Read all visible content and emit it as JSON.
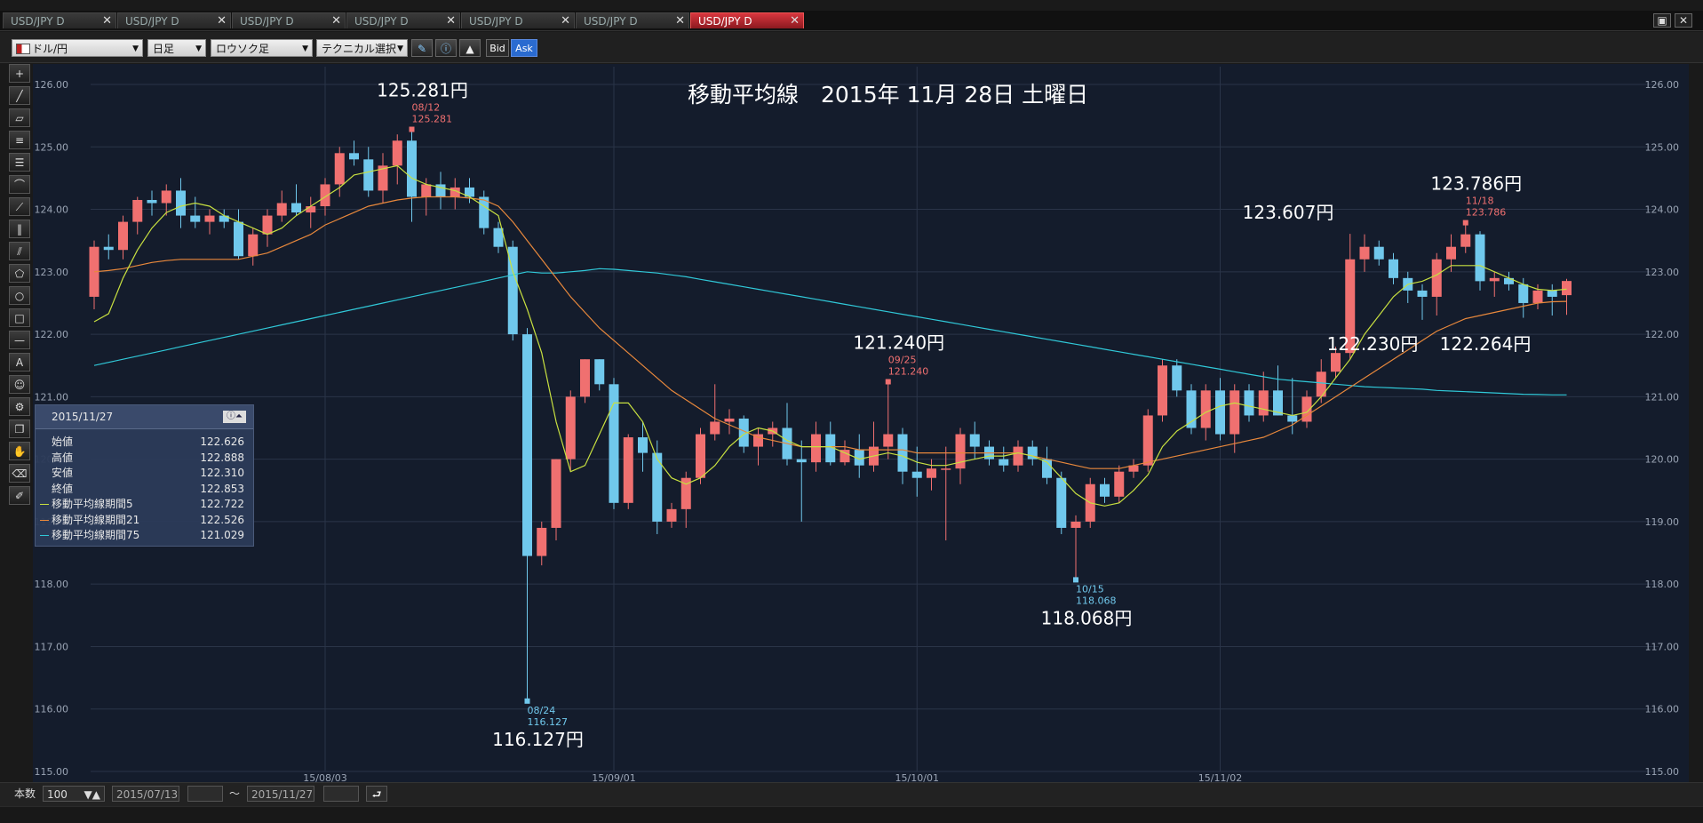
{
  "tabs": [
    {
      "label": "USD/JPY D",
      "active": false
    },
    {
      "label": "USD/JPY D",
      "active": false
    },
    {
      "label": "USD/JPY D",
      "active": false
    },
    {
      "label": "USD/JPY D",
      "active": false
    },
    {
      "label": "USD/JPY D",
      "active": false
    },
    {
      "label": "USD/JPY D",
      "active": false
    },
    {
      "label": "USD/JPY D",
      "active": true
    }
  ],
  "toolbar": {
    "currency": "ドル/円",
    "period": "日足",
    "chart_type": "ロウソク足",
    "technical": "テクニカル選択",
    "bid": "Bid",
    "ask": "Ask"
  },
  "footer": {
    "count_label": "本数",
    "count_value": "100",
    "date_from": "2015/07/13",
    "tilde": "〜",
    "date_to": "2015/11/27"
  },
  "info_panel": {
    "date": "2015/11/27",
    "rows": [
      {
        "label": "始値",
        "value": "122.626"
      },
      {
        "label": "高値",
        "value": "122.888"
      },
      {
        "label": "安値",
        "value": "122.310"
      },
      {
        "label": "終値",
        "value": "122.853"
      },
      {
        "label": "移動平均線期間5",
        "value": "122.722"
      },
      {
        "label": "移動平均線期間21",
        "value": "122.526"
      },
      {
        "label": "移動平均線期間75",
        "value": "121.029"
      }
    ]
  },
  "colors": {
    "up": "#f07070",
    "down": "#70c8ec",
    "ma5": "#c8e040",
    "ma21": "#e8883c",
    "ma75": "#30c8d8",
    "bg": "#141c2c"
  },
  "chart_data": {
    "type": "candlestick",
    "title": "移動平均線　2015年 11月 28日 土曜日",
    "ylim": [
      115.0,
      126.0
    ],
    "yticks": [
      "126.00",
      "125.00",
      "124.00",
      "123.00",
      "122.00",
      "121.00",
      "120.00",
      "119.00",
      "118.00",
      "117.00",
      "116.00",
      "115.00"
    ],
    "xticks": [
      {
        "index": 16,
        "label": "15/08/03"
      },
      {
        "index": 36,
        "label": "15/09/01"
      },
      {
        "index": 57,
        "label": "15/10/01"
      },
      {
        "index": 78,
        "label": "15/11/02"
      }
    ],
    "candles": [
      {
        "o": 122.6,
        "h": 123.5,
        "l": 122.4,
        "c": 123.4
      },
      {
        "o": 123.4,
        "h": 123.6,
        "l": 123.2,
        "c": 123.35
      },
      {
        "o": 123.35,
        "h": 123.9,
        "l": 123.2,
        "c": 123.8
      },
      {
        "o": 123.8,
        "h": 124.2,
        "l": 123.6,
        "c": 124.15
      },
      {
        "o": 124.15,
        "h": 124.3,
        "l": 123.9,
        "c": 124.1
      },
      {
        "o": 124.1,
        "h": 124.4,
        "l": 123.9,
        "c": 124.3
      },
      {
        "o": 124.3,
        "h": 124.5,
        "l": 123.7,
        "c": 123.9
      },
      {
        "o": 123.9,
        "h": 124.2,
        "l": 123.7,
        "c": 123.8
      },
      {
        "o": 123.8,
        "h": 124.0,
        "l": 123.6,
        "c": 123.9
      },
      {
        "o": 123.9,
        "h": 124.0,
        "l": 123.7,
        "c": 123.8
      },
      {
        "o": 123.8,
        "h": 124.0,
        "l": 123.2,
        "c": 123.25
      },
      {
        "o": 123.25,
        "h": 123.7,
        "l": 123.1,
        "c": 123.6
      },
      {
        "o": 123.6,
        "h": 124.0,
        "l": 123.4,
        "c": 123.9
      },
      {
        "o": 123.9,
        "h": 124.3,
        "l": 123.8,
        "c": 124.1
      },
      {
        "o": 124.1,
        "h": 124.4,
        "l": 123.9,
        "c": 123.95
      },
      {
        "o": 123.95,
        "h": 124.2,
        "l": 123.7,
        "c": 124.05
      },
      {
        "o": 124.05,
        "h": 124.5,
        "l": 123.9,
        "c": 124.4
      },
      {
        "o": 124.4,
        "h": 125.0,
        "l": 124.2,
        "c": 124.9
      },
      {
        "o": 124.9,
        "h": 125.1,
        "l": 124.7,
        "c": 124.8
      },
      {
        "o": 124.8,
        "h": 125.0,
        "l": 124.2,
        "c": 124.3
      },
      {
        "o": 124.3,
        "h": 124.9,
        "l": 124.1,
        "c": 124.7
      },
      {
        "o": 124.7,
        "h": 125.2,
        "l": 124.4,
        "c": 125.1
      },
      {
        "o": 125.1,
        "h": 125.281,
        "l": 123.8,
        "c": 124.2
      },
      {
        "o": 124.2,
        "h": 124.5,
        "l": 123.9,
        "c": 124.4
      },
      {
        "o": 124.4,
        "h": 124.6,
        "l": 124.0,
        "c": 124.2
      },
      {
        "o": 124.2,
        "h": 124.5,
        "l": 124.0,
        "c": 124.35
      },
      {
        "o": 124.35,
        "h": 124.5,
        "l": 124.1,
        "c": 124.2
      },
      {
        "o": 124.2,
        "h": 124.3,
        "l": 123.6,
        "c": 123.7
      },
      {
        "o": 123.7,
        "h": 123.8,
        "l": 123.3,
        "c": 123.4
      },
      {
        "o": 123.4,
        "h": 123.5,
        "l": 121.9,
        "c": 122.0
      },
      {
        "o": 122.0,
        "h": 122.1,
        "l": 116.127,
        "c": 118.45
      },
      {
        "o": 118.45,
        "h": 119.0,
        "l": 118.3,
        "c": 118.9
      },
      {
        "o": 118.9,
        "h": 120.0,
        "l": 118.7,
        "c": 120.0
      },
      {
        "o": 120.0,
        "h": 121.1,
        "l": 119.8,
        "c": 121.0
      },
      {
        "o": 121.0,
        "h": 121.6,
        "l": 120.9,
        "c": 121.6
      },
      {
        "o": 121.6,
        "h": 121.6,
        "l": 121.1,
        "c": 121.2
      },
      {
        "o": 121.2,
        "h": 121.3,
        "l": 119.2,
        "c": 119.3
      },
      {
        "o": 119.3,
        "h": 120.4,
        "l": 119.2,
        "c": 120.35
      },
      {
        "o": 120.35,
        "h": 120.6,
        "l": 119.8,
        "c": 120.1
      },
      {
        "o": 120.1,
        "h": 120.3,
        "l": 118.8,
        "c": 119.0
      },
      {
        "o": 119.0,
        "h": 119.3,
        "l": 118.9,
        "c": 119.2
      },
      {
        "o": 119.2,
        "h": 119.8,
        "l": 118.9,
        "c": 119.7
      },
      {
        "o": 119.7,
        "h": 120.5,
        "l": 119.6,
        "c": 120.4
      },
      {
        "o": 120.4,
        "h": 121.2,
        "l": 120.3,
        "c": 120.6
      },
      {
        "o": 120.6,
        "h": 120.8,
        "l": 120.4,
        "c": 120.65
      },
      {
        "o": 120.65,
        "h": 120.7,
        "l": 120.1,
        "c": 120.2
      },
      {
        "o": 120.2,
        "h": 120.5,
        "l": 119.9,
        "c": 120.4
      },
      {
        "o": 120.4,
        "h": 120.6,
        "l": 120.2,
        "c": 120.5
      },
      {
        "o": 120.5,
        "h": 120.9,
        "l": 119.9,
        "c": 120.0
      },
      {
        "o": 120.0,
        "h": 120.3,
        "l": 119.0,
        "c": 119.95
      },
      {
        "o": 119.95,
        "h": 120.6,
        "l": 119.8,
        "c": 120.4
      },
      {
        "o": 120.4,
        "h": 120.6,
        "l": 119.9,
        "c": 119.95
      },
      {
        "o": 119.95,
        "h": 120.3,
        "l": 119.9,
        "c": 120.15
      },
      {
        "o": 120.15,
        "h": 120.4,
        "l": 119.7,
        "c": 119.9
      },
      {
        "o": 119.9,
        "h": 120.6,
        "l": 119.8,
        "c": 120.2
      },
      {
        "o": 120.2,
        "h": 121.24,
        "l": 120.0,
        "c": 120.4
      },
      {
        "o": 120.4,
        "h": 120.5,
        "l": 119.6,
        "c": 119.8
      },
      {
        "o": 119.8,
        "h": 120.2,
        "l": 119.4,
        "c": 119.7
      },
      {
        "o": 119.7,
        "h": 120.0,
        "l": 119.5,
        "c": 119.85
      },
      {
        "o": 119.85,
        "h": 120.2,
        "l": 118.7,
        "c": 119.85
      },
      {
        "o": 119.85,
        "h": 120.5,
        "l": 119.6,
        "c": 120.4
      },
      {
        "o": 120.4,
        "h": 120.6,
        "l": 120.0,
        "c": 120.2
      },
      {
        "o": 120.2,
        "h": 120.3,
        "l": 119.9,
        "c": 120.0
      },
      {
        "o": 120.0,
        "h": 120.2,
        "l": 119.8,
        "c": 119.9
      },
      {
        "o": 119.9,
        "h": 120.3,
        "l": 119.8,
        "c": 120.2
      },
      {
        "o": 120.2,
        "h": 120.3,
        "l": 119.9,
        "c": 120.0
      },
      {
        "o": 120.0,
        "h": 120.2,
        "l": 119.6,
        "c": 119.7
      },
      {
        "o": 119.7,
        "h": 119.8,
        "l": 118.8,
        "c": 118.9
      },
      {
        "o": 118.9,
        "h": 119.1,
        "l": 118.068,
        "c": 119.0
      },
      {
        "o": 119.0,
        "h": 119.7,
        "l": 118.9,
        "c": 119.6
      },
      {
        "o": 119.6,
        "h": 119.7,
        "l": 119.3,
        "c": 119.4
      },
      {
        "o": 119.4,
        "h": 119.9,
        "l": 119.3,
        "c": 119.8
      },
      {
        "o": 119.8,
        "h": 120.0,
        "l": 119.7,
        "c": 119.9
      },
      {
        "o": 119.9,
        "h": 120.8,
        "l": 119.8,
        "c": 120.7
      },
      {
        "o": 120.7,
        "h": 121.6,
        "l": 120.6,
        "c": 121.5
      },
      {
        "o": 121.5,
        "h": 121.6,
        "l": 121.0,
        "c": 121.1
      },
      {
        "o": 121.1,
        "h": 121.2,
        "l": 120.4,
        "c": 120.5
      },
      {
        "o": 120.5,
        "h": 121.2,
        "l": 120.3,
        "c": 121.1
      },
      {
        "o": 121.1,
        "h": 121.3,
        "l": 120.3,
        "c": 120.4
      },
      {
        "o": 120.4,
        "h": 121.2,
        "l": 120.1,
        "c": 121.1
      },
      {
        "o": 121.1,
        "h": 121.2,
        "l": 120.6,
        "c": 120.7
      },
      {
        "o": 120.7,
        "h": 121.4,
        "l": 120.6,
        "c": 121.1
      },
      {
        "o": 121.1,
        "h": 121.5,
        "l": 120.7,
        "c": 120.7
      },
      {
        "o": 120.7,
        "h": 121.3,
        "l": 120.4,
        "c": 120.6
      },
      {
        "o": 120.6,
        "h": 121.1,
        "l": 120.5,
        "c": 121.0
      },
      {
        "o": 121.0,
        "h": 121.6,
        "l": 120.9,
        "c": 121.4
      },
      {
        "o": 121.4,
        "h": 121.8,
        "l": 121.3,
        "c": 121.7
      },
      {
        "o": 121.7,
        "h": 123.607,
        "l": 121.6,
        "c": 123.2
      },
      {
        "o": 123.2,
        "h": 123.6,
        "l": 123.0,
        "c": 123.4
      },
      {
        "o": 123.4,
        "h": 123.5,
        "l": 123.1,
        "c": 123.2
      },
      {
        "o": 123.2,
        "h": 123.3,
        "l": 122.8,
        "c": 122.9
      },
      {
        "o": 122.9,
        "h": 123.0,
        "l": 122.5,
        "c": 122.7
      },
      {
        "o": 122.7,
        "h": 122.8,
        "l": 122.23,
        "c": 122.6
      },
      {
        "o": 122.6,
        "h": 123.3,
        "l": 122.3,
        "c": 123.2
      },
      {
        "o": 123.2,
        "h": 123.6,
        "l": 123.0,
        "c": 123.4
      },
      {
        "o": 123.4,
        "h": 123.786,
        "l": 123.3,
        "c": 123.6
      },
      {
        "o": 123.6,
        "h": 123.65,
        "l": 122.7,
        "c": 122.85
      },
      {
        "o": 122.85,
        "h": 123.0,
        "l": 122.6,
        "c": 122.9
      },
      {
        "o": 122.9,
        "h": 123.0,
        "l": 122.7,
        "c": 122.8
      },
      {
        "o": 122.8,
        "h": 122.9,
        "l": 122.264,
        "c": 122.5
      },
      {
        "o": 122.5,
        "h": 122.8,
        "l": 122.4,
        "c": 122.7
      },
      {
        "o": 122.7,
        "h": 122.8,
        "l": 122.3,
        "c": 122.6
      },
      {
        "o": 122.626,
        "h": 122.888,
        "l": 122.31,
        "c": 122.853
      }
    ],
    "ma5": [
      122.2,
      122.33,
      122.9,
      123.35,
      123.7,
      123.95,
      124.05,
      124.1,
      124.05,
      123.9,
      123.8,
      123.7,
      123.6,
      123.7,
      123.9,
      124.05,
      124.2,
      124.35,
      124.55,
      124.6,
      124.65,
      124.7,
      124.5,
      124.4,
      124.35,
      124.3,
      124.2,
      124.05,
      123.9,
      123.0,
      122.4,
      121.7,
      120.6,
      119.8,
      119.9,
      120.4,
      120.9,
      120.9,
      120.6,
      120.0,
      119.7,
      119.6,
      119.7,
      119.9,
      120.2,
      120.4,
      120.5,
      120.45,
      120.3,
      120.2,
      120.2,
      120.2,
      120.1,
      120.0,
      120.05,
      120.1,
      120.05,
      119.95,
      119.9,
      119.9,
      119.95,
      120.0,
      120.05,
      120.05,
      120.1,
      120.05,
      119.95,
      119.7,
      119.45,
      119.3,
      119.25,
      119.3,
      119.5,
      119.75,
      120.2,
      120.45,
      120.6,
      120.75,
      120.85,
      120.9,
      120.85,
      120.8,
      120.75,
      120.7,
      120.75,
      121.0,
      121.3,
      121.6,
      122.0,
      122.3,
      122.6,
      122.8,
      122.85,
      122.95,
      123.1,
      123.1,
      123.1,
      123.0,
      122.9,
      122.8,
      122.72,
      122.7,
      122.722
    ],
    "ma21": [
      123.0,
      123.02,
      123.05,
      123.1,
      123.15,
      123.18,
      123.2,
      123.2,
      123.2,
      123.2,
      123.2,
      123.25,
      123.3,
      123.4,
      123.5,
      123.6,
      123.75,
      123.85,
      123.95,
      124.05,
      124.1,
      124.15,
      124.18,
      124.2,
      124.2,
      124.2,
      124.18,
      124.15,
      124.05,
      123.8,
      123.5,
      123.2,
      122.9,
      122.6,
      122.35,
      122.1,
      121.9,
      121.7,
      121.5,
      121.3,
      121.1,
      120.95,
      120.8,
      120.65,
      120.55,
      120.45,
      120.35,
      120.3,
      120.25,
      120.2,
      120.2,
      120.2,
      120.2,
      120.15,
      120.15,
      120.15,
      120.15,
      120.1,
      120.1,
      120.1,
      120.1,
      120.1,
      120.1,
      120.1,
      120.1,
      120.05,
      120.0,
      119.95,
      119.9,
      119.85,
      119.85,
      119.85,
      119.9,
      119.95,
      120.0,
      120.05,
      120.1,
      120.15,
      120.2,
      120.25,
      120.3,
      120.35,
      120.45,
      120.55,
      120.7,
      120.85,
      121.0,
      121.15,
      121.3,
      121.45,
      121.6,
      121.75,
      121.9,
      122.05,
      122.15,
      122.25,
      122.3,
      122.35,
      122.4,
      122.45,
      122.5,
      122.52,
      122.526
    ],
    "ma75": [
      121.5,
      121.55,
      121.6,
      121.65,
      121.7,
      121.75,
      121.8,
      121.85,
      121.9,
      121.95,
      122.0,
      122.05,
      122.1,
      122.15,
      122.2,
      122.25,
      122.3,
      122.35,
      122.4,
      122.45,
      122.5,
      122.55,
      122.6,
      122.65,
      122.7,
      122.75,
      122.8,
      122.85,
      122.9,
      122.95,
      123.0,
      122.98,
      122.98,
      123.0,
      123.02,
      123.05,
      123.04,
      123.02,
      123.0,
      122.98,
      122.95,
      122.92,
      122.88,
      122.84,
      122.8,
      122.76,
      122.72,
      122.68,
      122.64,
      122.6,
      122.56,
      122.52,
      122.48,
      122.44,
      122.4,
      122.36,
      122.32,
      122.28,
      122.24,
      122.2,
      122.16,
      122.12,
      122.08,
      122.04,
      122.0,
      121.96,
      121.92,
      121.88,
      121.84,
      121.8,
      121.76,
      121.72,
      121.68,
      121.64,
      121.6,
      121.56,
      121.52,
      121.48,
      121.44,
      121.4,
      121.36,
      121.32,
      121.28,
      121.26,
      121.24,
      121.22,
      121.2,
      121.18,
      121.16,
      121.15,
      121.14,
      121.13,
      121.12,
      121.1,
      121.09,
      121.08,
      121.07,
      121.06,
      121.05,
      121.04,
      121.035,
      121.03,
      121.029
    ],
    "annotations": [
      {
        "index": 22,
        "price": 125.281,
        "date": "08/12",
        "value": "125.281",
        "big": "125.281円",
        "kind": "high"
      },
      {
        "index": 30,
        "price": 116.127,
        "date": "08/24",
        "value": "116.127",
        "big": "116.127円",
        "kind": "low"
      },
      {
        "index": 55,
        "price": 121.24,
        "date": "09/25",
        "value": "121.240",
        "big": "121.240円",
        "kind": "high"
      },
      {
        "index": 68,
        "price": 118.068,
        "date": "10/15",
        "value": "118.068",
        "big": "118.068円",
        "kind": "low"
      },
      {
        "index": 95,
        "price": 123.786,
        "date": "11/18",
        "value": "123.786",
        "big": "123.786円",
        "kind": "high"
      }
    ],
    "extra_labels": [
      "123.607円",
      "122.230円",
      "122.264円"
    ]
  }
}
